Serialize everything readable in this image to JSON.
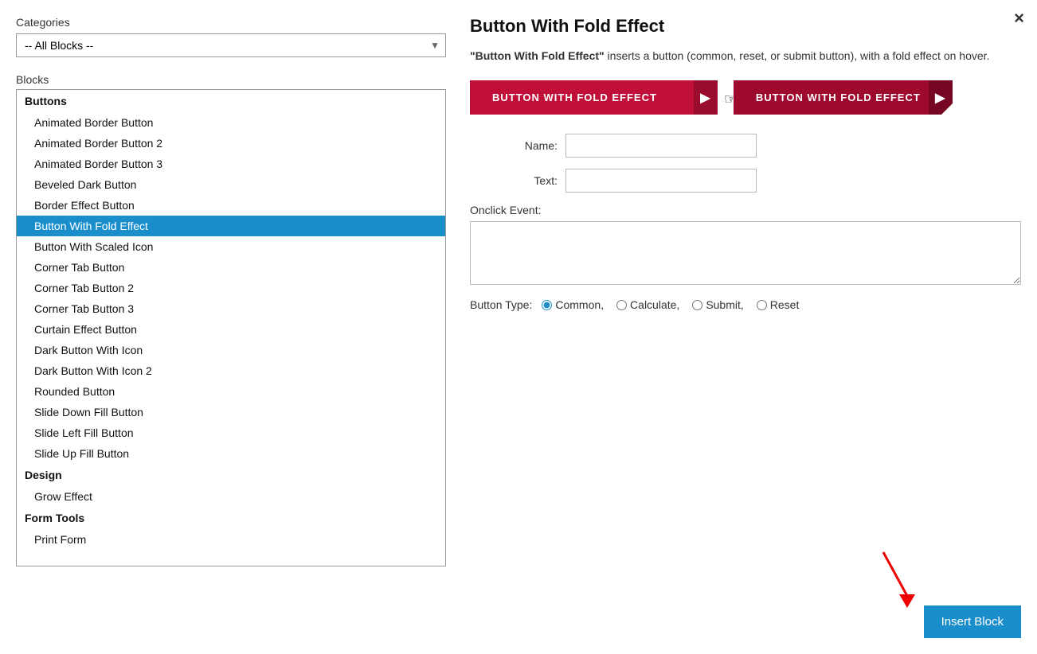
{
  "modal": {
    "close_label": "×",
    "title": "Button With Fold Effect",
    "description_bold": "\"Button With Fold Effect\"",
    "description_rest": " inserts a button (common, reset, or submit button), with a fold effect on hover.",
    "btn1_label": "BUTTON WITH FOLD EFFECT",
    "btn2_label": "BUTTON WITH FOLD EFFECT"
  },
  "left": {
    "categories_label": "Categories",
    "categories_option": "-- All Blocks --",
    "blocks_label": "Blocks",
    "groups": [
      {
        "name": "Buttons",
        "items": [
          "Animated Border Button",
          "Animated Border Button 2",
          "Animated Border Button 3",
          "Beveled Dark Button",
          "Border Effect Button",
          "Button With Fold Effect",
          "Button With Scaled Icon",
          "Corner Tab Button",
          "Corner Tab Button 2",
          "Corner Tab Button 3",
          "Curtain Effect Button",
          "Dark Button With Icon",
          "Dark Button With Icon 2",
          "Rounded Button",
          "Slide Down Fill Button",
          "Slide Left Fill Button",
          "Slide Up Fill Button"
        ]
      },
      {
        "name": "Design",
        "items": [
          "Grow Effect"
        ]
      },
      {
        "name": "Form Tools",
        "items": [
          "Print Form"
        ]
      }
    ]
  },
  "form": {
    "name_label": "Name:",
    "name_placeholder": "",
    "text_label": "Text:",
    "text_placeholder": "",
    "onclick_label": "Onclick Event:",
    "onclick_placeholder": "",
    "button_type_label": "Button Type:",
    "types": [
      "Common",
      "Calculate",
      "Submit",
      "Reset"
    ],
    "selected_type": "Common"
  },
  "footer": {
    "insert_label": "Insert Block"
  }
}
